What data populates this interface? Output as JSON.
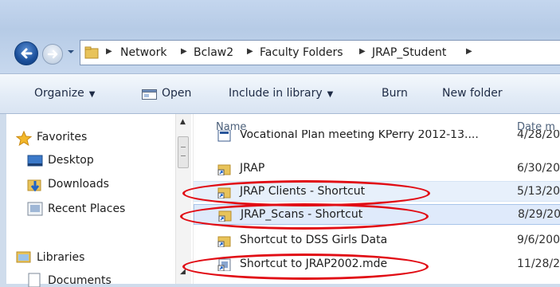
{
  "address": {
    "crumbs": [
      "Network",
      "Bclaw2",
      "Faculty Folders",
      "JRAP_Student"
    ]
  },
  "toolbar": {
    "organize": "Organize",
    "open": "Open",
    "include_in_library": "Include in library",
    "burn": "Burn",
    "new_folder": "New folder"
  },
  "nav": {
    "favorites": "Favorites",
    "desktop": "Desktop",
    "downloads": "Downloads",
    "recent_places": "Recent Places",
    "libraries": "Libraries",
    "documents": "Documents"
  },
  "columns": {
    "name": "Name",
    "date": "Date m"
  },
  "files": [
    {
      "name": "Vocational Plan meeting KPerry 2012-13....",
      "date": "4/28/20",
      "icon": "document-icon"
    },
    {
      "name": "JRAP",
      "date": "6/30/20",
      "icon": "folder-shortcut-icon"
    },
    {
      "name": "JRAP Clients - Shortcut",
      "date": "5/13/20",
      "icon": "folder-shortcut-icon"
    },
    {
      "name": "JRAP_Scans - Shortcut",
      "date": "8/29/20",
      "icon": "folder-shortcut-icon"
    },
    {
      "name": "Shortcut to DSS Girls Data",
      "date": "9/6/200",
      "icon": "folder-shortcut-icon"
    },
    {
      "name": "Shortcut to JRAP2002.mde",
      "date": "11/28/2",
      "icon": "database-shortcut-icon"
    }
  ],
  "colors": {
    "annotation": "#e10c14",
    "selection": "#dfeafb"
  }
}
